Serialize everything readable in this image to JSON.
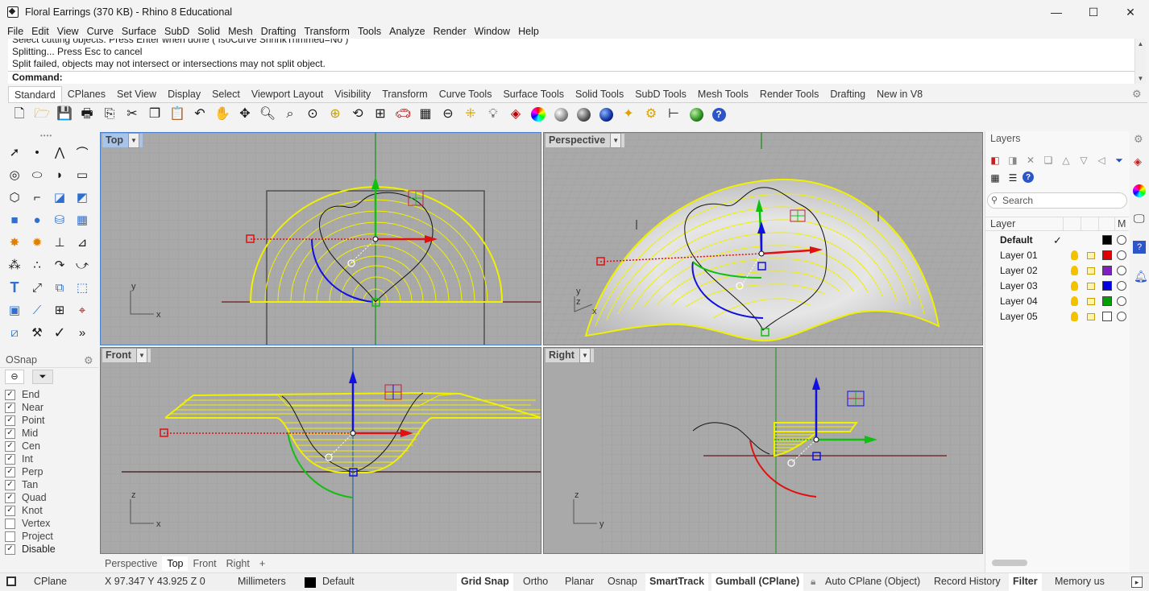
{
  "window": {
    "title": "Floral Earrings (370 KB) - Rhino 8 Educational",
    "minimize": "—",
    "maximize": "☐",
    "close": "✕"
  },
  "menu": [
    "File",
    "Edit",
    "View",
    "Curve",
    "Surface",
    "SubD",
    "Solid",
    "Mesh",
    "Drafting",
    "Transform",
    "Tools",
    "Analyze",
    "Render",
    "Window",
    "Help"
  ],
  "command": {
    "history": [
      "Select cutting objects. Press Enter when done ( IsoCurve ShrinkTrimmed=No )",
      "Splitting... Press Esc to cancel",
      "Split failed, objects may not intersect or intersections may not split object."
    ],
    "prompt": "Command:"
  },
  "toolbar_tabs": [
    "Standard",
    "CPlanes",
    "Set View",
    "Display",
    "Select",
    "Viewport Layout",
    "Visibility",
    "Transform",
    "Curve Tools",
    "Surface Tools",
    "Solid Tools",
    "SubD Tools",
    "Mesh Tools",
    "Render Tools",
    "Drafting",
    "New in V8"
  ],
  "toolbar_icons": [
    "new-file-icon",
    "open-file-icon",
    "save-icon",
    "print-icon",
    "import-icon",
    "cut-icon",
    "copy-icon",
    "paste-icon",
    "undo-icon",
    "pan-icon",
    "rotate-view-icon",
    "zoom-icon",
    "zoom-window-icon",
    "zoom-extents-icon",
    "zoom-selected-icon",
    "rotate-icon",
    "four-viewports-icon",
    "car-icon",
    "grid-icon",
    "cplane-icon",
    "points-icon",
    "lightbulb-icon",
    "layer-icon",
    "color-wheel-icon",
    "material-sphere-icon",
    "render-sphere-icon",
    "rendered-sphere-icon",
    "sun-icon",
    "settings-gears-icon",
    "dimension-icon",
    "globe-icon",
    "help-icon"
  ],
  "osnap": {
    "title": "OSnap",
    "items": [
      {
        "label": "End",
        "checked": true
      },
      {
        "label": "Near",
        "checked": true
      },
      {
        "label": "Point",
        "checked": true
      },
      {
        "label": "Mid",
        "checked": true
      },
      {
        "label": "Cen",
        "checked": true
      },
      {
        "label": "Int",
        "checked": true
      },
      {
        "label": "Perp",
        "checked": true
      },
      {
        "label": "Tan",
        "checked": true
      },
      {
        "label": "Quad",
        "checked": true
      },
      {
        "label": "Knot",
        "checked": true
      },
      {
        "label": "Vertex",
        "checked": false
      },
      {
        "label": "Project",
        "checked": false
      },
      {
        "label": "Disable",
        "checked": true
      }
    ]
  },
  "viewports": {
    "top": {
      "label": "Top",
      "axis_x": "x",
      "axis_y": "y"
    },
    "perspective": {
      "label": "Perspective",
      "axis_x": "x",
      "axis_y": "y",
      "axis_z": "z"
    },
    "front": {
      "label": "Front",
      "axis_x": "x",
      "axis_y": "z"
    },
    "right": {
      "label": "Right",
      "axis_x": "y",
      "axis_y": "z"
    }
  },
  "viewport_tabs": [
    "Perspective",
    "Top",
    "Front",
    "Right",
    "+"
  ],
  "layers": {
    "title": "Layers",
    "search_placeholder": "Search",
    "col_layer": "Layer",
    "col_m": "M",
    "rows": [
      {
        "name": "Default",
        "current": "✓",
        "color": "#000000"
      },
      {
        "name": "Layer 01",
        "color": "#e00000"
      },
      {
        "name": "Layer 02",
        "color": "#8020c0"
      },
      {
        "name": "Layer 03",
        "color": "#0000e0"
      },
      {
        "name": "Layer 04",
        "color": "#00a000"
      },
      {
        "name": "Layer 05",
        "color": "#ffffff"
      }
    ]
  },
  "status": {
    "cplane": "CPlane",
    "coords": "X 97.347 Y 43.925 Z 0",
    "units": "Millimeters",
    "layer": "Default",
    "grid_snap": "Grid Snap",
    "ortho": "Ortho",
    "planar": "Planar",
    "osnap": "Osnap",
    "smarttrack": "SmartTrack",
    "gumball": "Gumball (CPlane)",
    "auto_cplane": "Auto CPlane (Object)",
    "record_history": "Record History",
    "filter": "Filter",
    "memory": "Memory us"
  }
}
